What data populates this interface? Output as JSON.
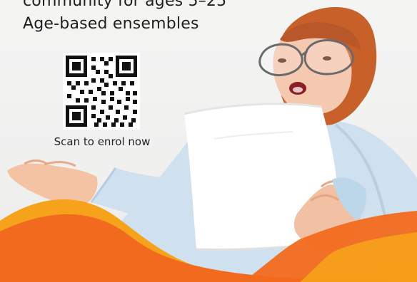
{
  "headline": {
    "line1": "community for ages 5–25",
    "line2": "Age-based ensembles"
  },
  "qr": {
    "icon": "qr-code-icon"
  },
  "cta": {
    "text": "Scan to enrol now"
  },
  "colors": {
    "background": "#f2f2f1",
    "text": "#1f1f1f",
    "wave_orange": "#f26a1d",
    "wave_yellow": "#f6a21a",
    "shirt": "#cfe2ef",
    "hair": "#c8602a",
    "paper": "#ffffff"
  }
}
